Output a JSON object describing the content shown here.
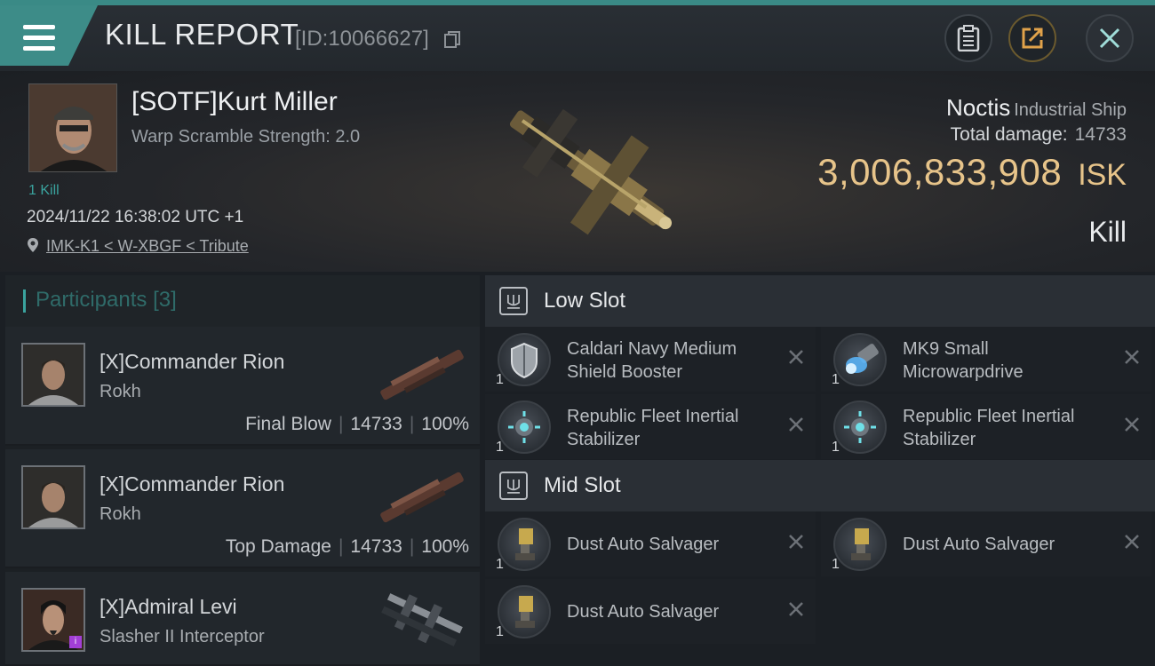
{
  "header": {
    "title": "KILL REPORT",
    "report_id": "[ID:10066627]",
    "colors": {
      "accent": "#3a8a86",
      "isk_gold": "#e7c48a"
    }
  },
  "victim": {
    "name": "[SOTF]Kurt Miller",
    "warp_scramble": "Warp Scramble Strength: 2.0",
    "kill_count": "1 Kill",
    "datetime": "2024/11/22 16:38:02 UTC +1",
    "location": "IMK-K1 < W-XBGF < Tribute",
    "ship_name": "Noctis",
    "ship_class": "Industrial Ship",
    "total_damage_label": "Total damage:",
    "total_damage": "14733",
    "isk_value": "3,006,833,908",
    "isk_unit": "ISK",
    "result": "Kill"
  },
  "participants": {
    "label": "Participants",
    "count": "[3]",
    "items": [
      {
        "name": "[X]Commander Rion",
        "ship": "Rokh",
        "role": "Final Blow",
        "damage": "14733",
        "percent": "100%"
      },
      {
        "name": "[X]Commander Rion",
        "ship": "Rokh",
        "role": "Top Damage",
        "damage": "14733",
        "percent": "100%"
      },
      {
        "name": "[X]Admiral Levi",
        "ship": "Slasher II Interceptor",
        "badge": "i"
      }
    ]
  },
  "fitting": {
    "low_slot": {
      "label": "Low Slot",
      "modules": [
        {
          "line1": "Caldari Navy Medium",
          "line2": "Shield Booster",
          "qty": "1",
          "icon": "shield-booster-icon"
        },
        {
          "line1": "MK9 Small",
          "line2": "Microwarpdrive",
          "qty": "1",
          "icon": "microwarpdrive-icon"
        },
        {
          "line1": "Republic Fleet Inertial",
          "line2": "Stabilizer",
          "qty": "1",
          "icon": "inertial-stabilizer-icon"
        },
        {
          "line1": "Republic Fleet Inertial",
          "line2": "Stabilizer",
          "qty": "1",
          "icon": "inertial-stabilizer-icon"
        }
      ]
    },
    "mid_slot": {
      "label": "Mid Slot",
      "modules": [
        {
          "line1": "Dust Auto Salvager",
          "qty": "1",
          "icon": "auto-salvager-icon"
        },
        {
          "line1": "Dust Auto Salvager",
          "qty": "1",
          "icon": "auto-salvager-icon"
        },
        {
          "line1": "Dust Auto Salvager",
          "qty": "1",
          "icon": "auto-salvager-icon"
        }
      ]
    }
  }
}
